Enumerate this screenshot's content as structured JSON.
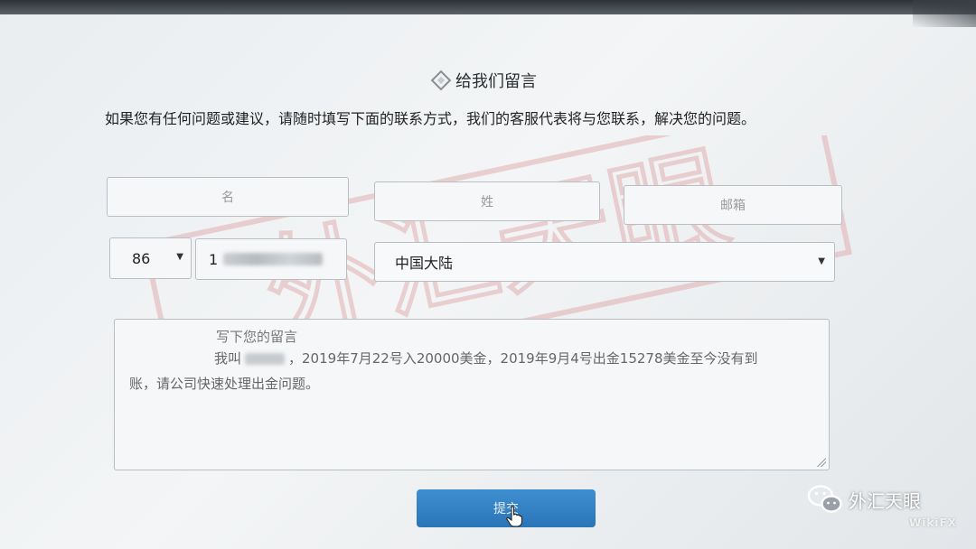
{
  "form": {
    "title": "给我们留言",
    "intro": "如果您有任何问题或建议，请随时填写下面的联系方式，我们的客服代表将与您联系，解决您的问题。",
    "first_name_placeholder": "名",
    "last_name_placeholder": "姓",
    "email_placeholder": "邮箱",
    "country_code": "86",
    "phone_prefix": "1",
    "country": "中国大陆",
    "message_placeholder": "写下您的留言",
    "message_line1_start": "我叫",
    "message_line1_rest": "，2019年7月22号入20000美金，2019年9月4号出金15278美金至今没有到",
    "message_line2": "账，请公司快速处理出金问题。",
    "submit_label": "提交"
  },
  "branding": {
    "watermark_text": "外汇天眼",
    "badge_text": "外汇天眼",
    "badge_sub": "WikiFX"
  },
  "icons": {
    "title_icon": "diamond-icon",
    "dropdown": "caret-down-icon",
    "cursor": "hand-cursor-icon",
    "brand": "wechat-icon"
  },
  "colors": {
    "submit": "#2f7fc1",
    "watermark": "#e0a0a0"
  }
}
